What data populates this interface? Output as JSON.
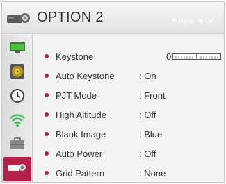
{
  "header": {
    "title": "OPTION 2",
    "icon": "projector-icon",
    "hints": {
      "move": "Move",
      "ok": "OK"
    }
  },
  "sidebar": {
    "tabs": [
      {
        "icon": "picture-icon",
        "active": false
      },
      {
        "icon": "audio-speaker-icon",
        "active": false
      },
      {
        "icon": "clock-icon",
        "active": false
      },
      {
        "icon": "wifi-network-icon",
        "active": false
      },
      {
        "icon": "briefcase-option-icon",
        "active": false
      },
      {
        "icon": "projector-icon",
        "active": true
      }
    ]
  },
  "menu": {
    "items": [
      {
        "label": "Keystone",
        "value": "0",
        "slider_level": 0
      },
      {
        "label": "Auto Keystone",
        "value": ": On"
      },
      {
        "label": "PJT Mode",
        "value": ": Front"
      },
      {
        "label": "High Altitude",
        "value": ": Off"
      },
      {
        "label": "Blank Image",
        "value": ": Blue"
      },
      {
        "label": "Auto Power",
        "value": ": Off"
      },
      {
        "label": "Grid Pattern",
        "value": ": None"
      }
    ]
  },
  "colors": {
    "accent": "#b3204a",
    "text": "#333333",
    "panel": "#f3f3f3"
  }
}
